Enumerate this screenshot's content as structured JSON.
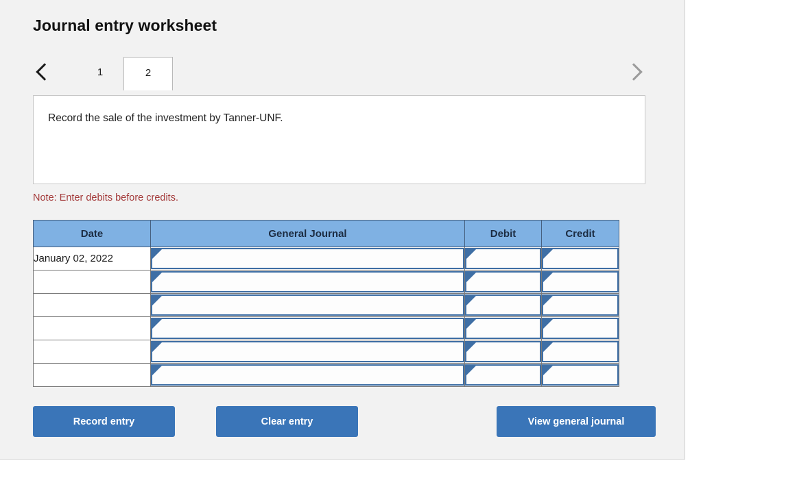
{
  "page": {
    "title": "Journal entry worksheet"
  },
  "tabs": {
    "prev_icon": "chevron-left-icon",
    "next_icon": "chevron-right-icon",
    "items": [
      {
        "label": "1",
        "active": false
      },
      {
        "label": "2",
        "active": true
      }
    ]
  },
  "instruction": {
    "text": "Record the sale of the investment by Tanner-UNF."
  },
  "note": {
    "text": "Note: Enter debits before credits."
  },
  "table": {
    "headers": [
      "Date",
      "General Journal",
      "Debit",
      "Credit"
    ],
    "rows": [
      {
        "date": "January 02, 2022",
        "general_journal": "",
        "debit": "",
        "credit": ""
      },
      {
        "date": "",
        "general_journal": "",
        "debit": "",
        "credit": ""
      },
      {
        "date": "",
        "general_journal": "",
        "debit": "",
        "credit": ""
      },
      {
        "date": "",
        "general_journal": "",
        "debit": "",
        "credit": ""
      },
      {
        "date": "",
        "general_journal": "",
        "debit": "",
        "credit": ""
      },
      {
        "date": "",
        "general_journal": "",
        "debit": "",
        "credit": ""
      }
    ]
  },
  "buttons": {
    "record": "Record entry",
    "clear": "Clear entry",
    "view": "View general journal"
  },
  "colors": {
    "panel_background": "#f2f2f2",
    "header_blue": "#7fb1e3",
    "button_blue": "#3a75b8",
    "note_red": "#a43b3b",
    "input_border": "#3f6fa5"
  }
}
